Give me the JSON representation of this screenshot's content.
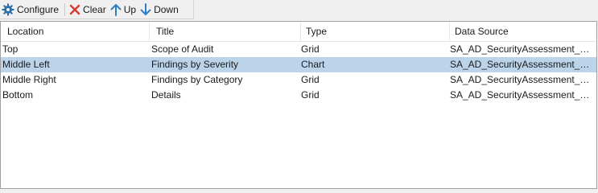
{
  "toolbar": {
    "configure_label": "Configure",
    "clear_label": "Clear",
    "up_label": "Up",
    "down_label": "Down"
  },
  "colors": {
    "configure_icon": "#2e6ea8",
    "clear_icon": "#d83b2f",
    "arrow_icon": "#2f7fc4",
    "selected_row": "#bcd4ea"
  },
  "table": {
    "columns": [
      "Location",
      "Title",
      "Type",
      "Data Source"
    ],
    "rows": [
      [
        "Top",
        "Scope of Audit",
        "Grid",
        "SA_AD_SecurityAssessment_Scope"
      ],
      [
        "Middle Left",
        "Findings by Severity",
        "Chart",
        "SA_AD_SecurityAssessment_Results"
      ],
      [
        "Middle Right",
        "Findings by Category",
        "Grid",
        "SA_AD_SecurityAssessment_Results"
      ],
      [
        "Bottom",
        "Details",
        "Grid",
        "SA_AD_SecurityAssessment_Results"
      ]
    ],
    "selected_row": 1
  }
}
